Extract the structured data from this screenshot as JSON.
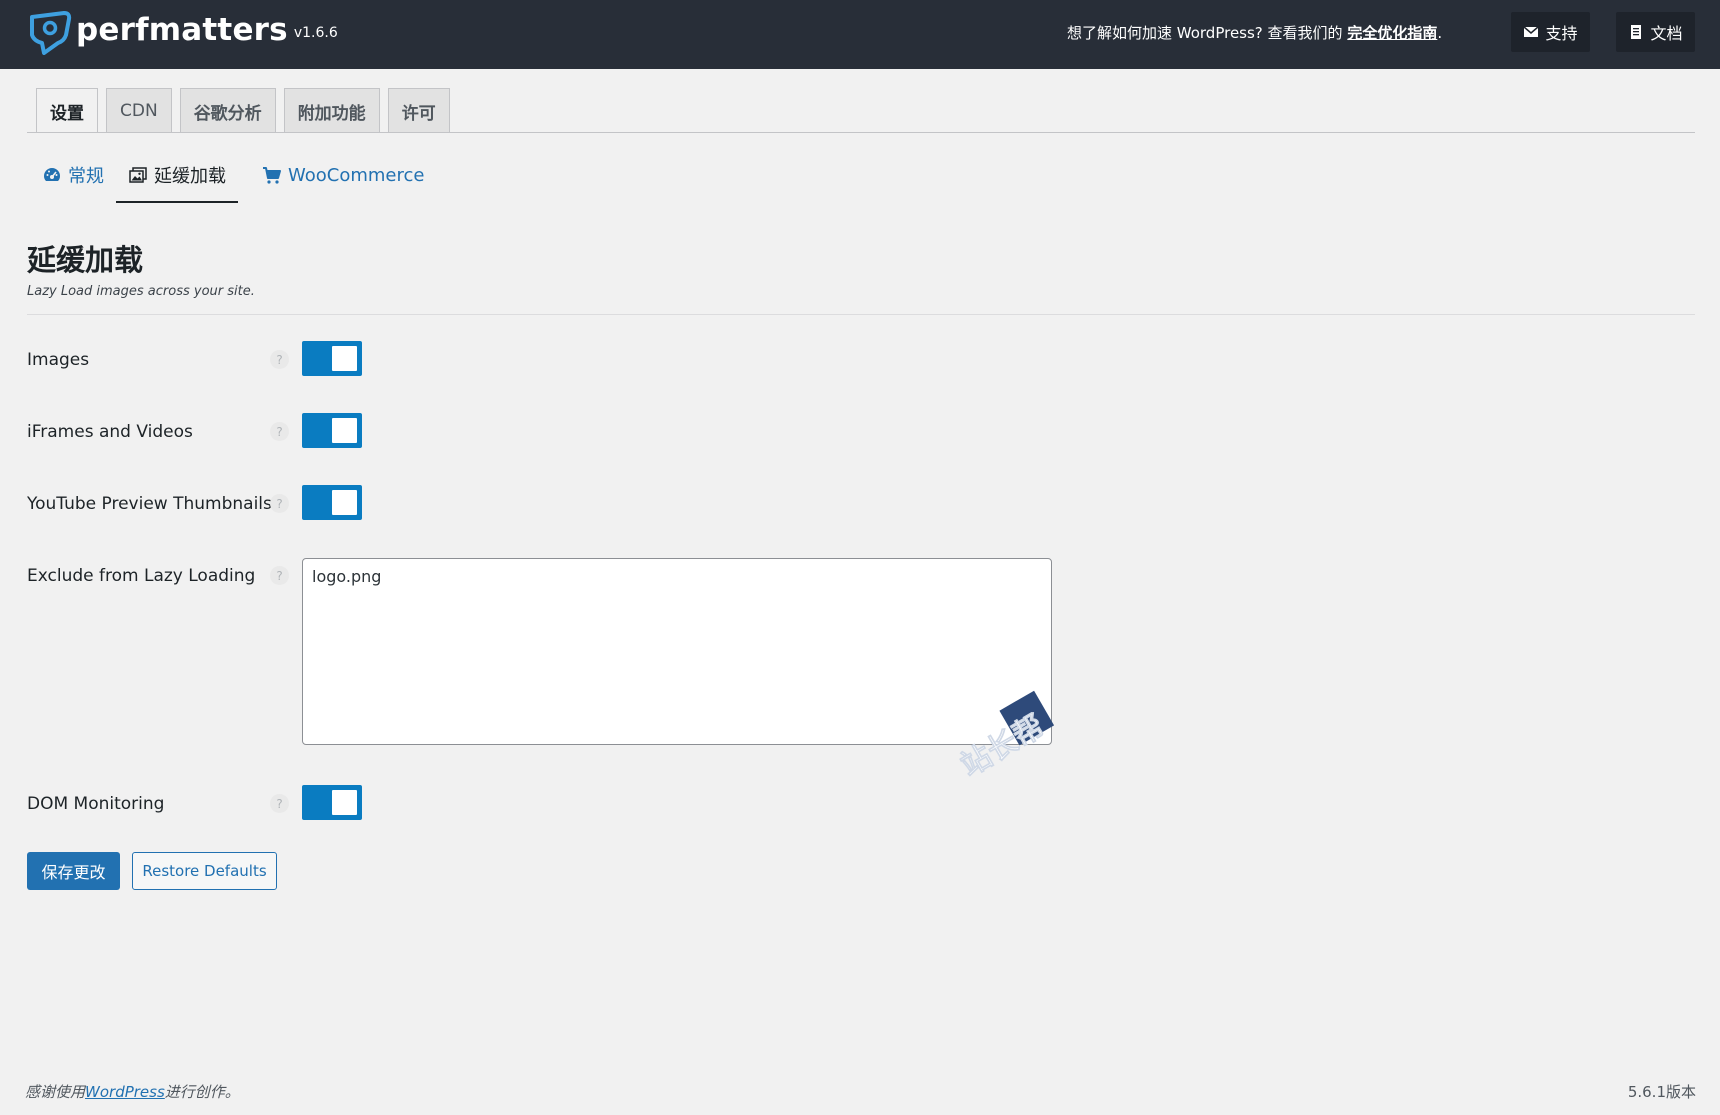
{
  "header": {
    "brand": "perfmatters",
    "version": "v1.6.6",
    "guide_prefix": "想了解如何加速 WordPress? 查看我们的 ",
    "guide_link": "完全优化指南",
    "guide_suffix": ".",
    "support_label": "支持",
    "docs_label": "文档"
  },
  "tabs": [
    {
      "label": "设置",
      "active": true
    },
    {
      "label": "CDN",
      "active": false
    },
    {
      "label": "谷歌分析",
      "active": false
    },
    {
      "label": "附加功能",
      "active": false
    },
    {
      "label": "许可",
      "active": false
    }
  ],
  "subnav": [
    {
      "label": "常规",
      "icon": "dashboard-icon",
      "active": false
    },
    {
      "label": "延缓加载",
      "icon": "images-icon",
      "active": true
    },
    {
      "label": "WooCommerce",
      "icon": "cart-icon",
      "active": false
    }
  ],
  "section": {
    "title": "延缓加载",
    "description": "Lazy Load images across your site."
  },
  "settings": {
    "images": {
      "label": "Images",
      "enabled": true
    },
    "iframes": {
      "label": "iFrames and Videos",
      "enabled": true
    },
    "youtube": {
      "label": "YouTube Preview Thumbnails",
      "enabled": true
    },
    "exclude": {
      "label": "Exclude from Lazy Loading",
      "value": "logo.png"
    },
    "dom": {
      "label": "DOM Monitoring",
      "enabled": true
    }
  },
  "help_glyph": "?",
  "buttons": {
    "save": "保存更改",
    "restore": "Restore Defaults"
  },
  "watermark": {
    "text": "站长帮"
  },
  "footer": {
    "prefix": "感谢使用",
    "link": "WordPress",
    "suffix": "进行创作。",
    "version": "5.6.1版本"
  },
  "colors": {
    "header_bg": "#282e38",
    "accent": "#2271b1",
    "toggle_on": "#0a7cc1"
  }
}
